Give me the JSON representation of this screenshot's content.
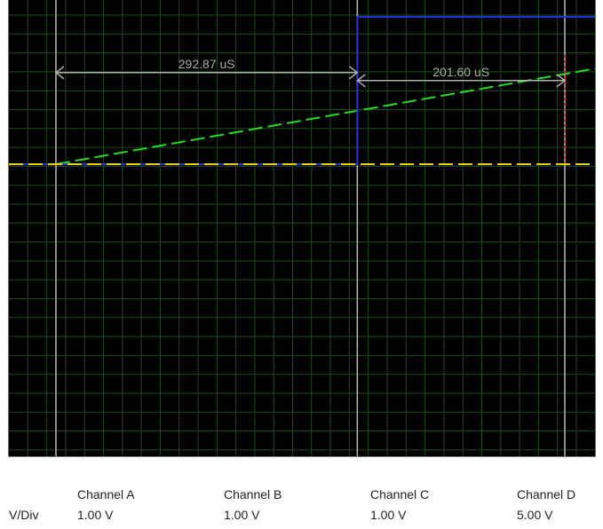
{
  "chart_data": {
    "type": "line",
    "grid": true,
    "background": "#000000",
    "grid_color": "#1f4a1f",
    "cursors": [
      {
        "name": "cursor-1",
        "time_div": 0.5
      },
      {
        "name": "cursor-2",
        "time_div": 6.6
      },
      {
        "name": "cursor-3",
        "time_div": 10.8
      }
    ],
    "measurements": [
      {
        "label": "292.87 uS",
        "from_div": 0.5,
        "to_div": 6.6,
        "level_div": 8.5
      },
      {
        "label": "201.60 uS",
        "from_div": 6.6,
        "to_div": 10.8,
        "level_div": 8.3
      }
    ],
    "series": [
      {
        "name": "Channel A",
        "color": "#22dd22",
        "style": "dashed",
        "points": [
          [
            0.5,
            6.2
          ],
          [
            12.0,
            8.6
          ]
        ]
      },
      {
        "name": "Channel B",
        "color": "#dd2222",
        "style": "dotted",
        "points": [
          [
            10.8,
            6.2
          ],
          [
            10.8,
            9.0
          ]
        ]
      },
      {
        "name": "Channel C",
        "color": "#2233dd",
        "style": "solid",
        "points": [
          [
            -0.5,
            6.2
          ],
          [
            6.6,
            6.2
          ],
          [
            6.6,
            9.9
          ],
          [
            12.0,
            9.9
          ]
        ]
      },
      {
        "name": "Channel D",
        "color": "#e8d400",
        "style": "dashed",
        "points": [
          [
            -0.5,
            6.2
          ],
          [
            12.0,
            6.2
          ]
        ]
      }
    ]
  },
  "legend": {
    "vdiv_label": "V/Div",
    "channels": [
      {
        "name": "Channel A",
        "vdiv": "1.00 V",
        "color": "#22dd22",
        "dash": "14,4"
      },
      {
        "name": "Channel B",
        "vdiv": "1.00 V",
        "color": "#dd2222",
        "dash": "3,3"
      },
      {
        "name": "Channel C",
        "vdiv": "1.00 V",
        "color": "#2233dd",
        "dash": "18,3,5,3"
      },
      {
        "name": "Channel D",
        "vdiv": "5.00 V",
        "color": "#e8d400",
        "dash": "12,6"
      }
    ]
  }
}
